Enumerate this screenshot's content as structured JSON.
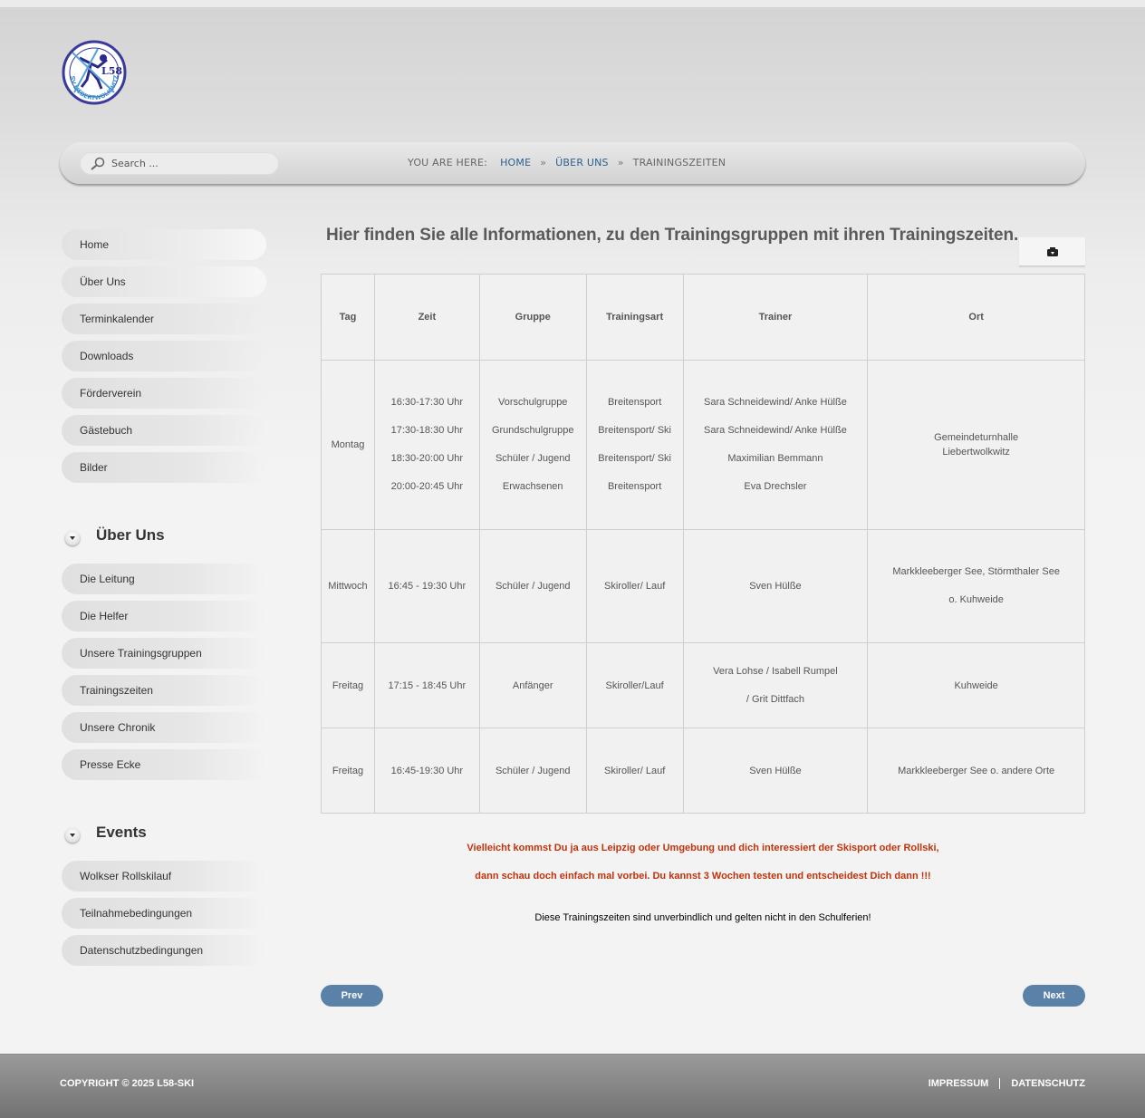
{
  "logo": {
    "text": "SV LIEBERTWOLKWITZ e.V.",
    "badge": "L58"
  },
  "search": {
    "placeholder": "Search ..."
  },
  "breadcrumb": {
    "label": "YOU ARE HERE:",
    "items": [
      "HOME",
      "ÜBER UNS",
      "TRAININGSZEITEN"
    ],
    "separator": "»"
  },
  "sidebar": {
    "main_menu": [
      "Home",
      "Über Uns",
      "Terminkalender",
      "Downloads",
      "Förderverein",
      "Gästebuch",
      "Bilder"
    ],
    "section1": {
      "title": "Über Uns",
      "items": [
        "Die Leitung",
        "Die Helfer",
        "Unsere Trainingsgruppen",
        "Trainingszeiten",
        "Unsere Chronik",
        "Presse Ecke"
      ]
    },
    "section2": {
      "title": "Events",
      "items": [
        "Wolkser Rollskilauf",
        "Teilnahmebedingungen",
        "Datenschutzbedingungen"
      ]
    }
  },
  "main": {
    "title": "Hier finden Sie alle Informationen, zu den Trainingsgruppen mit ihren Trainingszeiten.",
    "print_icon": "print-icon",
    "table": {
      "headers": [
        "Tag",
        "Zeit",
        "Gruppe",
        "Trainingsart",
        "Trainer",
        "Ort"
      ],
      "rows": [
        {
          "tag": "Montag",
          "zeit": [
            "16:30-17:30 Uhr",
            "17:30-18:30 Uhr",
            "18:30-20:00 Uhr",
            "20:00-20:45 Uhr"
          ],
          "gruppe": [
            "Vorschulgruppe",
            "Grundschulgruppe",
            "Schüler / Jugend",
            "Erwachsenen"
          ],
          "art": [
            "Breitensport",
            "Breitensport/ Ski",
            "Breitensport/ Ski",
            "Breitensport"
          ],
          "trainer": [
            "Sara Schneidewind/ Anke Hülße",
            "Sara Schneidewind/ Anke Hülße",
            "Maximilian Bemmann",
            "Eva Drechsler"
          ],
          "ort": [
            "Gemeindeturnhalle",
            "Liebertwolkwitz"
          ]
        },
        {
          "tag": "Mittwoch",
          "zeit": [
            "16:45 - 19:30 Uhr"
          ],
          "gruppe": [
            "Schüler / Jugend"
          ],
          "art": [
            "Skiroller/ Lauf"
          ],
          "trainer": [
            "Sven Hülße"
          ],
          "ort": [
            "Markkleeberger See, Störmthaler See",
            "o. Kuhweide"
          ]
        },
        {
          "tag": "Freitag",
          "zeit": [
            "17:15 - 18:45 Uhr"
          ],
          "gruppe": [
            "Anfänger"
          ],
          "art": [
            "Skiroller/Lauf"
          ],
          "trainer": [
            "Vera Lohse / Isabell Rumpel",
            "/ Grit Dittfach"
          ],
          "ort": [
            "Kuhweide"
          ]
        },
        {
          "tag": "Freitag",
          "zeit": [
            "16:45-19:30 Uhr"
          ],
          "gruppe": [
            "Schüler / Jugend"
          ],
          "art": [
            "Skiroller/ Lauf"
          ],
          "trainer": [
            "Sven Hülße"
          ],
          "ort": [
            "Markkleeberger See o. andere Orte"
          ]
        }
      ]
    },
    "note_red_1": "Vielleicht kommst Du ja aus Leipzig oder Umgebung und dich interessiert der Skisport oder Rollski,",
    "note_red_2": "dann schau doch einfach mal vorbei. Du kannst 3 Wochen testen und entscheidest Dich dann !!!",
    "note_black": "Diese Trainingszeiten sind unverbindlich und gelten nicht in den Schulferien!",
    "prev_label": "Prev",
    "next_label": "Next"
  },
  "footer": {
    "copyright": "COPYRIGHT © 2025 L58-SKI",
    "links": [
      "IMPRESSUM",
      "DATENSCHUTZ"
    ]
  },
  "colors": {
    "accent": "#2b5f8e",
    "button": "#5a82a8",
    "note_red": "#c0330b"
  }
}
